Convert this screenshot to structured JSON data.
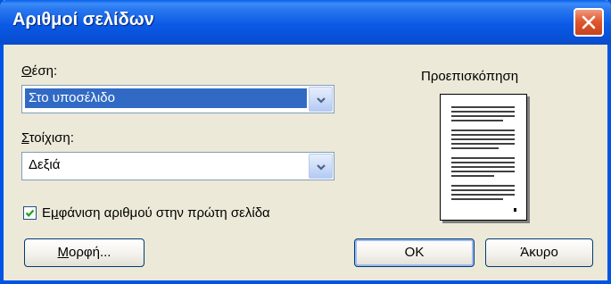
{
  "window": {
    "title": "Αριθμοί σελίδων",
    "close_icon": "close-icon"
  },
  "position": {
    "label_underlined": "Θ",
    "label_rest": "έση:",
    "value": "Στο υποσέλιδο"
  },
  "alignment": {
    "label_underlined": "Σ",
    "label_rest": "τοίχιση:",
    "value": "Δεξιά"
  },
  "show_first_page": {
    "checked": true,
    "label_before": "Ε",
    "label_underlined": "μ",
    "label_after": "φάνιση αριθμού στην πρώτη σελίδα"
  },
  "preview": {
    "label": "Προεπισκόπηση"
  },
  "buttons": {
    "format_underlined": "Μ",
    "format_rest": "ορφή...",
    "ok": "OK",
    "cancel": "Άκυρο"
  },
  "colors": {
    "title_bar": "#0a5fe8",
    "dialog_bg": "#ece9d8",
    "selection": "#316ac5",
    "close_button": "#e0582f"
  }
}
